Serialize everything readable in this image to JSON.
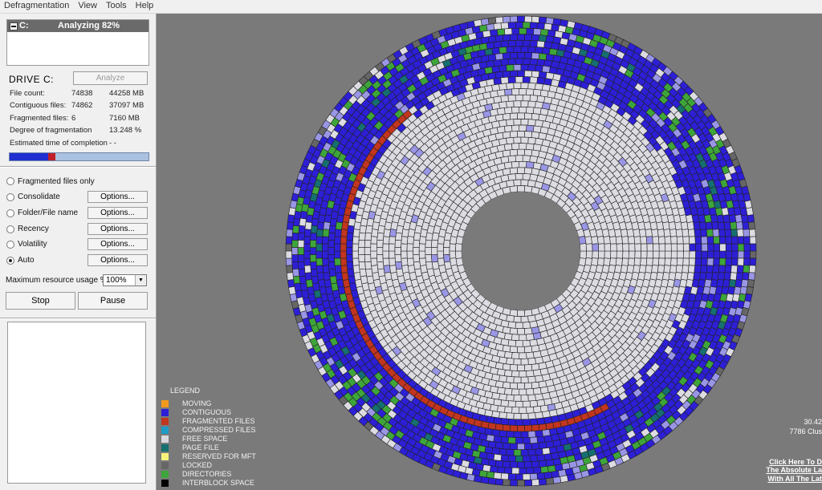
{
  "menu": [
    "Defragmentation",
    "View",
    "Tools",
    "Help"
  ],
  "drive_panel": {
    "drive_label": "C:",
    "status": "Analyzing 82%",
    "title": "DRIVE C:",
    "analyze_label": "Analyze",
    "stats": [
      {
        "label": "File count:",
        "value1": "74838",
        "value2": "44258 MB"
      },
      {
        "label": "Contiguous files:",
        "value1": "74862",
        "value2": "37097 MB"
      },
      {
        "label": "Fragmented files:",
        "value1": "6",
        "value2": "7160 MB"
      },
      {
        "label": "Degree of fragmentation",
        "value1": "",
        "value2": "13.248 %"
      },
      {
        "label": "Estimated time of completion",
        "value1": "- -",
        "value2": ""
      }
    ],
    "progress_fraction": 0.33
  },
  "options": [
    {
      "label": "Fragmented files only",
      "checked": false,
      "has_options": false
    },
    {
      "label": "Consolidate",
      "checked": false,
      "has_options": true
    },
    {
      "label": "Folder/File name",
      "checked": false,
      "has_options": true
    },
    {
      "label": "Recency",
      "checked": false,
      "has_options": true
    },
    {
      "label": "Volatility",
      "checked": false,
      "has_options": true
    },
    {
      "label": "Auto",
      "checked": true,
      "has_options": true
    }
  ],
  "options_button_label": "Options...",
  "resource": {
    "label": "Maximum resource usage %",
    "value": "100%"
  },
  "stop_label": "Stop",
  "pause_label": "Pause",
  "legend": {
    "title": "LEGEND",
    "items": [
      {
        "label": "MOVING",
        "color": "#f39a1e"
      },
      {
        "label": "CONTIGUOUS",
        "color": "#2d1fd6"
      },
      {
        "label": "FRAGMENTED FILES",
        "color": "#c2351e"
      },
      {
        "label": "COMPRESSED FILES",
        "color": "#1e9bc4"
      },
      {
        "label": "FREE SPACE",
        "color": "#d9d9de"
      },
      {
        "label": "PAGE FILE",
        "color": "#166f70"
      },
      {
        "label": "RESERVED FOR MFT",
        "color": "#f6f27c"
      },
      {
        "label": "LOCKED",
        "color": "#666666"
      },
      {
        "label": "DIRECTORIES",
        "color": "#3ea53a"
      },
      {
        "label": "INTERBLOCK SPACE",
        "color": "#000000"
      }
    ]
  },
  "side_info": {
    "line1": "30.42",
    "line2": "7786 Clus",
    "link1": "Click Here To D",
    "link2": "The Absolute La",
    "link3": "With All The Lat"
  },
  "colors": {
    "contiguous": "#2d1fd6",
    "fragmented": "#c2351e",
    "free": "#dcdce2",
    "directories": "#3ea53a",
    "locked": "#666666",
    "page": "#166f70",
    "light_blue": "#9a96e6",
    "background": "#7a7a7a"
  }
}
